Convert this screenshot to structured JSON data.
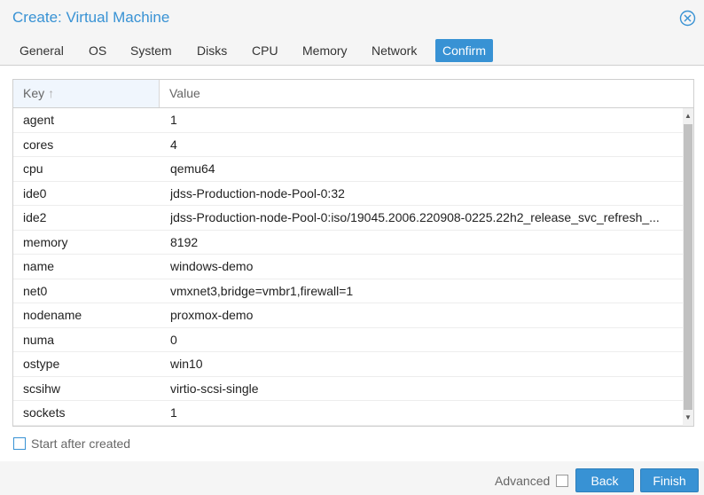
{
  "window": {
    "title": "Create: Virtual Machine",
    "accent_color": "#3892d4"
  },
  "tabs": [
    {
      "label": "General"
    },
    {
      "label": "OS"
    },
    {
      "label": "System"
    },
    {
      "label": "Disks"
    },
    {
      "label": "CPU"
    },
    {
      "label": "Memory"
    },
    {
      "label": "Network"
    },
    {
      "label": "Confirm",
      "active": true
    }
  ],
  "grid": {
    "columns": {
      "key": "Key",
      "value": "Value"
    },
    "sort_icon": "arrow-up-icon",
    "rows": [
      {
        "key": "agent",
        "value": "1"
      },
      {
        "key": "cores",
        "value": "4"
      },
      {
        "key": "cpu",
        "value": "qemu64"
      },
      {
        "key": "ide0",
        "value": "jdss-Production-node-Pool-0:32"
      },
      {
        "key": "ide2",
        "value": "jdss-Production-node-Pool-0:iso/19045.2006.220908-0225.22h2_release_svc_refresh_..."
      },
      {
        "key": "memory",
        "value": "8192"
      },
      {
        "key": "name",
        "value": "windows-demo"
      },
      {
        "key": "net0",
        "value": "vmxnet3,bridge=vmbr1,firewall=1"
      },
      {
        "key": "nodename",
        "value": "proxmox-demo"
      },
      {
        "key": "numa",
        "value": "0"
      },
      {
        "key": "ostype",
        "value": "win10"
      },
      {
        "key": "scsihw",
        "value": "virtio-scsi-single"
      },
      {
        "key": "sockets",
        "value": "1"
      }
    ]
  },
  "options": {
    "start_after_created": "Start after created"
  },
  "footer": {
    "advanced_label": "Advanced",
    "back_label": "Back",
    "finish_label": "Finish"
  }
}
